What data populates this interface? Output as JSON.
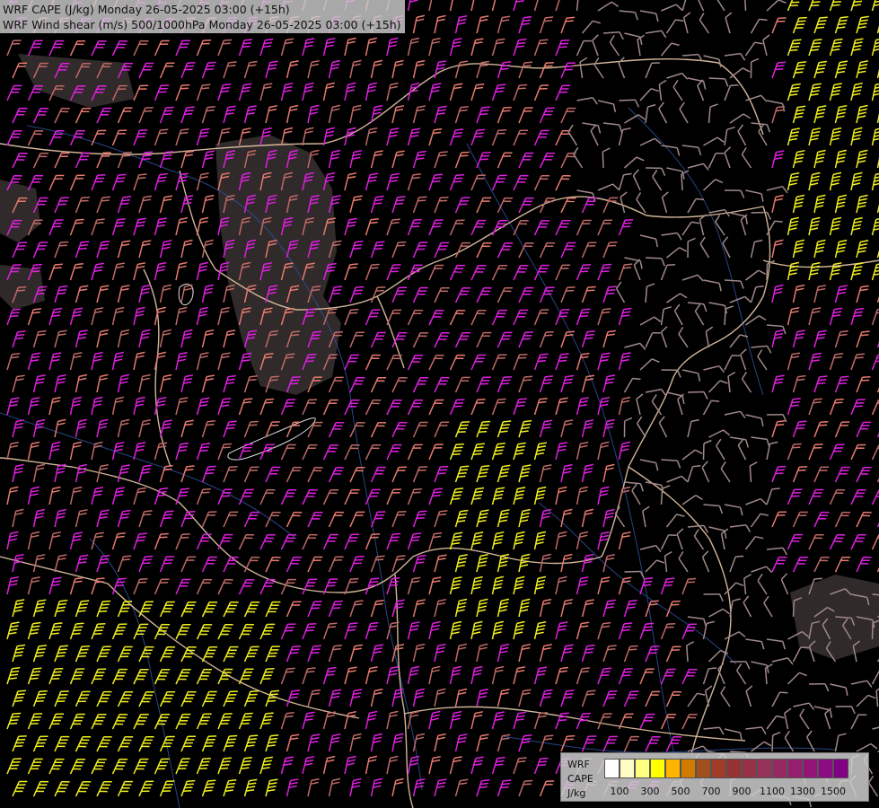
{
  "header": {
    "line1": "WRF CAPE (J/kg) Monday 26-05-2025 03:00 (+15h)",
    "line2": "WRF Wind shear (m/s) 500/1000hPa Monday 26-05-2025 03:00 (+15h)"
  },
  "legend": {
    "label1": "WRF",
    "label2": "CAPE",
    "label3": "J/kg",
    "colors": [
      "#ffffff",
      "#fffcc8",
      "#ffff80",
      "#ffff00",
      "#ffb400",
      "#d07a00",
      "#a0501e",
      "#a03c28",
      "#963232",
      "#963246",
      "#96325a",
      "#962864",
      "#961e6e",
      "#961478",
      "#8c0a82",
      "#820082"
    ],
    "ticks": [
      "100",
      "300",
      "500",
      "700",
      "900",
      "1100",
      "1300",
      "1500"
    ]
  },
  "colors": {
    "background": "#000000",
    "border": "#e8c8a8",
    "river": "#3050a0",
    "barb_magenta": "#e020e0",
    "barb_salmon": "#e87a70",
    "barb_rose": "#c06a68",
    "barb_yellow": "#f0f020",
    "barb_gray": "#a08888"
  }
}
